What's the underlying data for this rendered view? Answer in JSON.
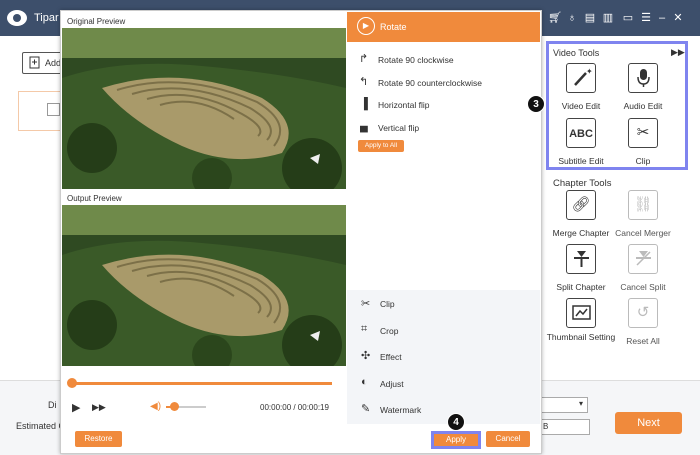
{
  "app": {
    "title": "Tipar",
    "add_file_label": "Add",
    "bottom": {
      "destination_label": "Di",
      "estimated_label": "Estimated Ca",
      "size_value": "B",
      "next_label": "Next"
    }
  },
  "video_tools": {
    "title": "Video Tools",
    "items": [
      {
        "label": "Video Edit",
        "icon": "magic-wand-icon"
      },
      {
        "label": "Audio Edit",
        "icon": "microphone-icon"
      },
      {
        "label": "Subtitle Edit",
        "icon": "abc-icon"
      },
      {
        "label": "Clip",
        "icon": "scissors-icon"
      }
    ]
  },
  "chapter_tools": {
    "title": "Chapter Tools",
    "items": [
      {
        "label": "Merge Chapter",
        "icon": "link-icon",
        "enabled": true
      },
      {
        "label": "Cancel Merger",
        "icon": "unlink-icon",
        "enabled": false
      },
      {
        "label": "Split Chapter",
        "icon": "split-icon",
        "enabled": true
      },
      {
        "label": "Cancel Split",
        "icon": "cancel-split-icon",
        "enabled": false
      },
      {
        "label": "Thumbnail Setting",
        "icon": "thumbnail-icon",
        "enabled": true
      },
      {
        "label": "Reset All",
        "icon": "reset-icon",
        "enabled": false
      }
    ]
  },
  "dialog": {
    "original_label": "Original Preview",
    "output_label": "Output Preview",
    "time": "00:00:00 / 00:00:19",
    "progress": 0.0,
    "volume": 0.2,
    "restore_label": "Restore",
    "apply_label": "Apply",
    "cancel_label": "Cancel",
    "rotate": {
      "header": "Rotate",
      "options": [
        "Rotate 90 clockwise",
        "Rotate 90 counterclockwise",
        "Horizontal flip",
        "Vertical flip"
      ],
      "apply_all_label": "Apply to All"
    },
    "menu": [
      "Clip",
      "Crop",
      "Effect",
      "Adjust",
      "Watermark"
    ]
  },
  "badges": {
    "step3": "3",
    "step4": "4"
  },
  "colors": {
    "accent": "#f08a3c",
    "highlight": "#7f84ef",
    "titlebar": "#3d4f6b"
  }
}
